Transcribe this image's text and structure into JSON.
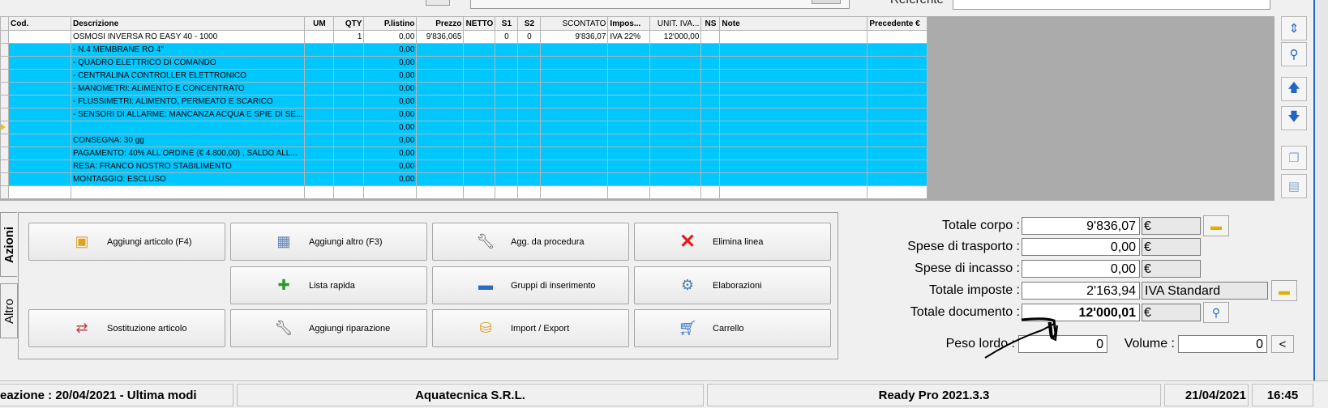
{
  "top": {
    "referente_label": "Referente"
  },
  "grid": {
    "headers": [
      "Cod.",
      "Descrizione",
      "UM",
      "QTY",
      "P.listino",
      "Prezzo",
      "NETTO",
      "S1",
      "S2",
      "SCONTATO",
      "Impos...",
      "UNIT. IVA...",
      "NS",
      "Note",
      "Precedente €"
    ],
    "rows": [
      [
        "",
        "OSMOSI INVERSA RO EASY 40 - 1000",
        "",
        "1",
        "0,00",
        "9'836,065",
        "",
        "0",
        "0",
        "9'836,07",
        "IVA 22%",
        "12'000,00",
        "",
        "",
        ""
      ],
      [
        "",
        "- N.4 MEMBRANE RO 4\"",
        "",
        "",
        "0,00",
        "",
        "",
        "",
        "",
        "",
        "",
        "",
        "",
        "",
        ""
      ],
      [
        "",
        "- QUADRO ELETTRICO DI COMANDO",
        "",
        "",
        "0,00",
        "",
        "",
        "",
        "",
        "",
        "",
        "",
        "",
        "",
        ""
      ],
      [
        "",
        "- CENTRALINA CONTROLLER ELETTRONICO",
        "",
        "",
        "0,00",
        "",
        "",
        "",
        "",
        "",
        "",
        "",
        "",
        "",
        ""
      ],
      [
        "",
        "- MANOMETRI: ALIMENTO E CONCENTRATO",
        "",
        "",
        "0,00",
        "",
        "",
        "",
        "",
        "",
        "",
        "",
        "",
        "",
        ""
      ],
      [
        "",
        "- FLUSSIMETRI: ALIMENTO, PERMEATO E SCARICO",
        "",
        "",
        "0,00",
        "",
        "",
        "",
        "",
        "",
        "",
        "",
        "",
        "",
        ""
      ],
      [
        "",
        "- SENSORI DI ALLARME: MANCANZA ACQUA E SPIE DI SE...",
        "",
        "",
        "0,00",
        "",
        "",
        "",
        "",
        "",
        "",
        "",
        "",
        "",
        ""
      ],
      [
        "",
        "",
        "",
        "",
        "0,00",
        "",
        "",
        "",
        "",
        "",
        "",
        "",
        "",
        "",
        ""
      ],
      [
        "",
        "CONSEGNA: 30 gg",
        "",
        "",
        "0,00",
        "",
        "",
        "",
        "",
        "",
        "",
        "",
        "",
        "",
        ""
      ],
      [
        "",
        "PAGAMENTO: 40% ALL'ORDINE (€ 4.800,00) , SALDO ALL...",
        "",
        "",
        "0,00",
        "",
        "",
        "",
        "",
        "",
        "",
        "",
        "",
        "",
        ""
      ],
      [
        "",
        "RESA: FRANCO NOSTRO STABILIMENTO",
        "",
        "",
        "0,00",
        "",
        "",
        "",
        "",
        "",
        "",
        "",
        "",
        "",
        ""
      ],
      [
        "",
        "MONTAGGIO: ESCLUSO",
        "",
        "",
        "0,00",
        "",
        "",
        "",
        "",
        "",
        "",
        "",
        "",
        "",
        ""
      ],
      [
        "",
        "",
        "",
        "",
        "",
        "",
        "",
        "",
        "",
        "",
        "",
        "",
        "",
        "",
        ""
      ]
    ]
  },
  "tabs": {
    "azioni": "Azioni",
    "altro": "Altro"
  },
  "actions": {
    "aggiungi_articolo": "Aggiungi articolo (F4)",
    "aggiungi_altro": "Aggiungi altro (F3)",
    "agg_procedura": "Agg. da procedura",
    "elimina_linea": "Elimina linea",
    "lista_rapida": "Lista rapida",
    "gruppi_inserimento": "Gruppi di inserimento",
    "elaborazioni": "Elaborazioni",
    "sostituzione_articolo": "Sostituzione articolo",
    "aggiungi_riparazione": "Aggiungi riparazione",
    "import_export": "Import / Export",
    "carrello": "Carrello"
  },
  "totals": {
    "totale_corpo_label": "Totale corpo :",
    "totale_corpo": "9'836,07",
    "spese_trasporto_label": "Spese di trasporto :",
    "spese_trasporto": "0,00",
    "spese_incasso_label": "Spese di incasso :",
    "spese_incasso": "0,00",
    "totale_imposte_label": "Totale imposte :",
    "totale_imposte": "2'163,94",
    "iva_type": "IVA Standard",
    "totale_documento_label": "Totale documento :",
    "totale_documento": "12'000,01",
    "currency": "€",
    "peso_lordo_label": "Peso lordo :",
    "peso_lordo": "0",
    "volume_label": "Volume :",
    "volume": "0",
    "less_btn": "<"
  },
  "status": {
    "creazione": "eazione : 20/04/2021 - Ultima modi",
    "company": "Aquatecnica S.R.L.",
    "app": "Ready Pro 2021.3.3",
    "date": "21/04/2021",
    "time": "16:45"
  },
  "colors": {
    "row_blue": "#00c8ff",
    "accent": "#1e66c8"
  }
}
